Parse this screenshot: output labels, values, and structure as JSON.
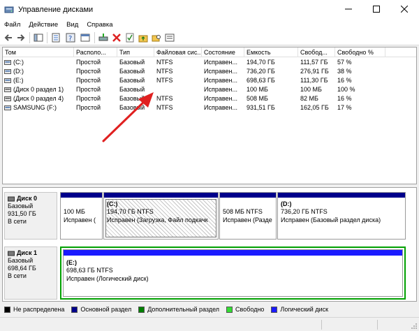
{
  "window": {
    "title": "Управление дисками"
  },
  "menu": [
    "Файл",
    "Действие",
    "Вид",
    "Справка"
  ],
  "columns": [
    "Том",
    "Располо...",
    "Тип",
    "Файловая сис...",
    "Состояние",
    "Емкость",
    "Свобод...",
    "Свободно %"
  ],
  "volumes": [
    {
      "name": "(C:)",
      "layout": "Простой",
      "type": "Базовый",
      "fs": "NTFS",
      "status": "Исправен...",
      "capacity": "194,70 ГБ",
      "free": "111,57 ГБ",
      "free_pct": "57 %"
    },
    {
      "name": "(D:)",
      "layout": "Простой",
      "type": "Базовый",
      "fs": "NTFS",
      "status": "Исправен...",
      "capacity": "736,20 ГБ",
      "free": "276,91 ГБ",
      "free_pct": "38 %"
    },
    {
      "name": "(E:)",
      "layout": "Простой",
      "type": "Базовый",
      "fs": "NTFS",
      "status": "Исправен...",
      "capacity": "698,63 ГБ",
      "free": "111,30 ГБ",
      "free_pct": "16 %"
    },
    {
      "name": "(Диск 0 раздел 1)",
      "layout": "Простой",
      "type": "Базовый",
      "fs": "",
      "status": "Исправен...",
      "capacity": "100 МБ",
      "free": "100 МБ",
      "free_pct": "100 %"
    },
    {
      "name": "(Диск 0 раздел 4)",
      "layout": "Простой",
      "type": "Базовый",
      "fs": "NTFS",
      "status": "Исправен...",
      "capacity": "508 МБ",
      "free": "82 МБ",
      "free_pct": "16 %"
    },
    {
      "name": "SAMSUNG (F:)",
      "layout": "Простой",
      "type": "Базовый",
      "fs": "NTFS",
      "status": "Исправен...",
      "capacity": "931,51 ГБ",
      "free": "162,05 ГБ",
      "free_pct": "17 %"
    }
  ],
  "disks": [
    {
      "name": "Диск 0",
      "type": "Базовый",
      "size": "931,50 ГБ",
      "state": "В сети",
      "partitions": [
        {
          "line1": "",
          "line2": "100 МБ",
          "line3": "Исправен ("
        },
        {
          "line1": "(C:)",
          "line2": "194,70 ГБ NTFS",
          "line3": "Исправен (Загрузка, Файл подкачк"
        },
        {
          "line1": "",
          "line2": "508 МБ NTFS",
          "line3": "Исправен (Разде"
        },
        {
          "line1": "(D:)",
          "line2": "736,20 ГБ NTFS",
          "line3": "Исправен (Базовый раздел диска)"
        }
      ]
    },
    {
      "name": "Диск 1",
      "type": "Базовый",
      "size": "698,64 ГБ",
      "state": "В сети",
      "partitions": [
        {
          "line1": "(E:)",
          "line2": "698,63 ГБ NTFS",
          "line3": "Исправен (Логический диск)"
        }
      ]
    }
  ],
  "legend": [
    {
      "label": "Не распределена",
      "color": "#000000"
    },
    {
      "label": "Основной раздел",
      "color": "#00008b"
    },
    {
      "label": "Дополнительный раздел",
      "color": "#008000"
    },
    {
      "label": "Свободно",
      "color": "#33dd33"
    },
    {
      "label": "Логический диск",
      "color": "#1a1aff"
    }
  ],
  "colors": {
    "primary_partition": "#00008b",
    "extended_partition": "#008000",
    "logical_drive": "#1a1aff",
    "annotation_arrow": "#e02020"
  }
}
